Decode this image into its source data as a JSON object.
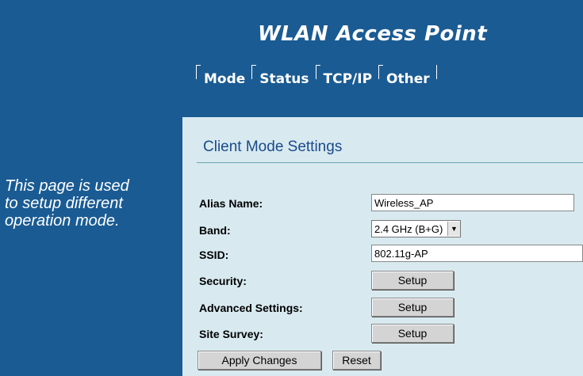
{
  "header": {
    "title": "WLAN Access Point",
    "tabs": [
      "Mode",
      "Status",
      "TCP/IP",
      "Other"
    ]
  },
  "sidebar": {
    "description": "This page is used to setup different operation mode."
  },
  "main": {
    "section_title": "Client Mode Settings",
    "fields": {
      "alias_label": "Alias Name:",
      "alias_value": "Wireless_AP",
      "band_label": "Band:",
      "band_value": "2.4 GHz (B+G)",
      "ssid_label": "SSID:",
      "ssid_value": "802.11g-AP",
      "security_label": "Security:",
      "advanced_label": "Advanced Settings:",
      "survey_label": "Site Survey:",
      "setup_label": "Setup"
    },
    "buttons": {
      "apply": "Apply Changes",
      "reset": "Reset"
    }
  },
  "colors": {
    "brand_blue": "#1a5b93",
    "content_bg": "#d8eaf0",
    "section_title": "#1a4a8c"
  }
}
